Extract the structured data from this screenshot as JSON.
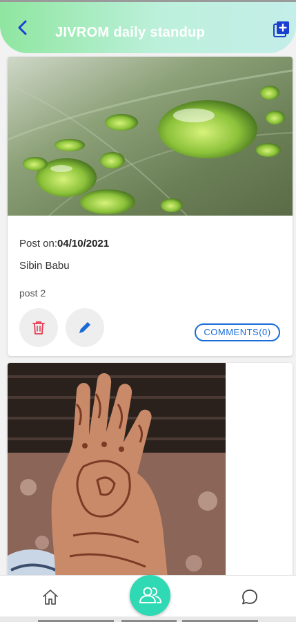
{
  "header": {
    "title": "JIVROM daily standup",
    "back_icon": "back-arrow-icon",
    "add_icon": "add-post-icon"
  },
  "posts": [
    {
      "date_label": "Post on:",
      "date": "04/10/2021",
      "author": "Sibin Babu",
      "content": "post 2",
      "comments_label": "COMMENTS(0)",
      "image": "green leaf with water drops",
      "delete_icon": "trash-icon",
      "edit_icon": "pencil-icon"
    },
    {
      "image": "hand with henna pattern"
    }
  ],
  "bottom_nav": {
    "items": [
      "home-icon",
      "group-icon",
      "chat-icon"
    ],
    "active": "group-icon"
  },
  "colors": {
    "accent": "#1a6bd8",
    "fab": "#2ed9b4",
    "delete": "#e53950",
    "header_start": "#8fe6a0",
    "header_end": "#c4eee9"
  }
}
